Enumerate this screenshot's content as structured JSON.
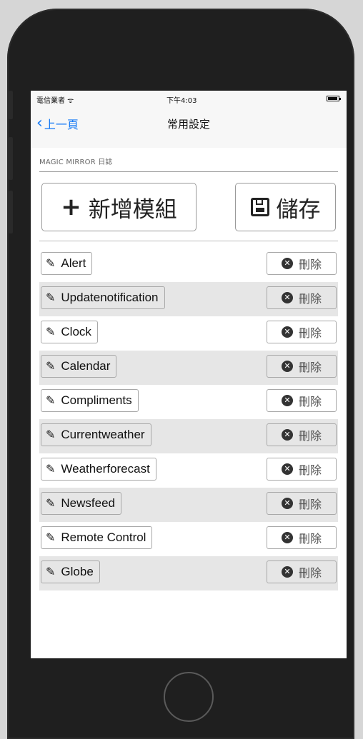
{
  "status_bar": {
    "carrier": "電信業者 ᯤ",
    "time": "下午4:03"
  },
  "nav": {
    "back_label": "上一頁",
    "title": "常用設定"
  },
  "section": {
    "title": "MAGIC MIRROR 日誌"
  },
  "actions": {
    "add_label": "新增模組",
    "save_label": "儲存"
  },
  "delete_label": "刪除",
  "modules": [
    {
      "name": "Alert"
    },
    {
      "name": "Updatenotification"
    },
    {
      "name": "Clock"
    },
    {
      "name": "Calendar"
    },
    {
      "name": "Compliments"
    },
    {
      "name": "Currentweather"
    },
    {
      "name": "Weatherforecast"
    },
    {
      "name": "Newsfeed"
    },
    {
      "name": "Remote Control"
    },
    {
      "name": "Globe"
    }
  ],
  "icons": {
    "back": "chevron-left-icon",
    "add": "plus-icon",
    "save": "floppy-icon",
    "edit": "pencil-icon",
    "delete": "x-circle-icon"
  },
  "colors": {
    "accent": "#1479f5",
    "row_alt": "#e6e6e6",
    "bezel": "#1f1f1f"
  }
}
